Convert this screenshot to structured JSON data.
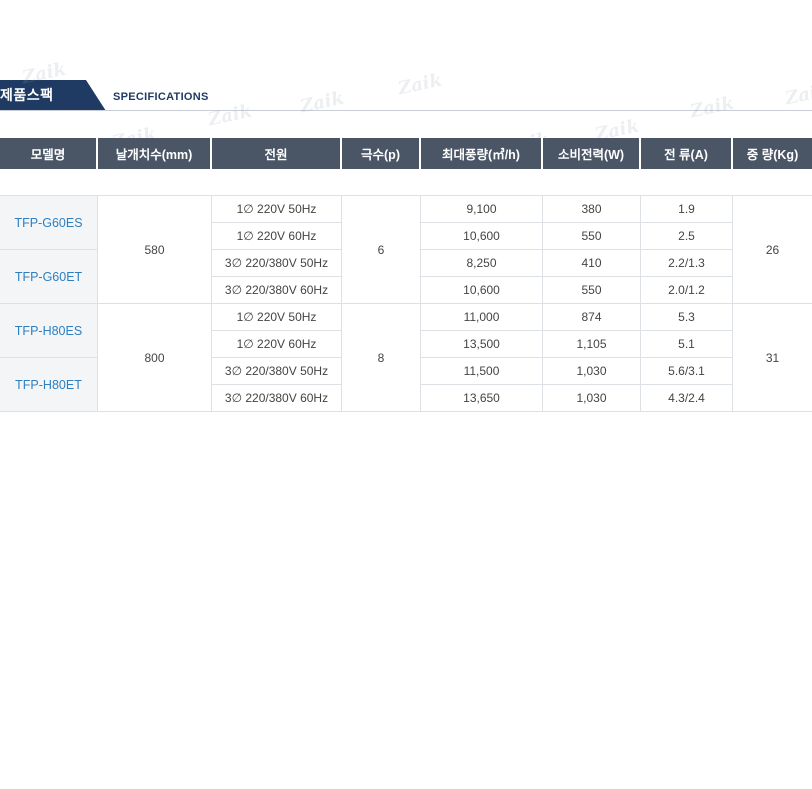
{
  "header": {
    "title_ko": "제품스팩",
    "title_en": "SPECIFICATIONS",
    "bar_color": "#1f3b63",
    "watermark": "Zaik"
  },
  "table": {
    "columns": [
      "모델명",
      "날개치수(mm)",
      "전원",
      "극수(p)",
      "최대풍량(㎥/h)",
      "소비전력(W)",
      "전 류(A)",
      "중 량(Kg)"
    ],
    "groups": [
      {
        "models": [
          "TFP-G60ES",
          "TFP-G60ET"
        ],
        "blade": "580",
        "poles": "6",
        "weight": "26",
        "rows": [
          {
            "power": "1∅ 220V 50Hz",
            "flow": "9,100",
            "watts": "380",
            "current": "1.9"
          },
          {
            "power": "1∅ 220V 60Hz",
            "flow": "10,600",
            "watts": "550",
            "current": "2.5"
          },
          {
            "power": "3∅ 220/380V 50Hz",
            "flow": "8,250",
            "watts": "410",
            "current": "2.2/1.3"
          },
          {
            "power": "3∅ 220/380V 60Hz",
            "flow": "10,600",
            "watts": "550",
            "current": "2.0/1.2"
          }
        ]
      },
      {
        "models": [
          "TFP-H80ES",
          "TFP-H80ET"
        ],
        "blade": "800",
        "poles": "8",
        "weight": "31",
        "rows": [
          {
            "power": "1∅ 220V 50Hz",
            "flow": "11,000",
            "watts": "874",
            "current": "5.3"
          },
          {
            "power": "1∅ 220V 60Hz",
            "flow": "13,500",
            "watts": "1,105",
            "current": "5.1"
          },
          {
            "power": "3∅ 220/380V 50Hz",
            "flow": "11,500",
            "watts": "1,030",
            "current": "5.6/3.1"
          },
          {
            "power": "3∅ 220/380V 60Hz",
            "flow": "13,650",
            "watts": "1,030",
            "current": "4.3/2.4"
          }
        ]
      }
    ]
  }
}
